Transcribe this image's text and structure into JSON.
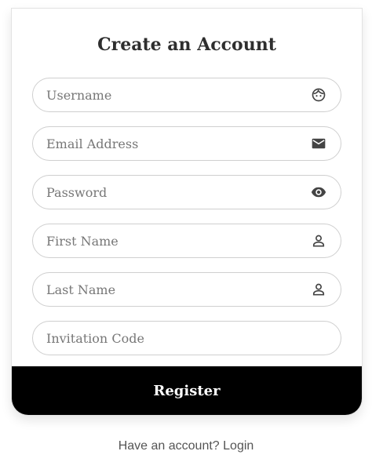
{
  "form": {
    "title": "Create an Account",
    "fields": [
      {
        "placeholder": "Username",
        "value": "",
        "icon": "face-icon"
      },
      {
        "placeholder": "Email Address",
        "value": "",
        "icon": "email-icon"
      },
      {
        "placeholder": "Password",
        "value": "",
        "icon": "eye-icon"
      },
      {
        "placeholder": "First Name",
        "value": "",
        "icon": "person-icon"
      },
      {
        "placeholder": "Last Name",
        "value": "",
        "icon": "person-icon"
      },
      {
        "placeholder": "Invitation Code",
        "value": "",
        "icon": ""
      }
    ],
    "register_label": "Register"
  },
  "footer": {
    "prompt": "Have an account?",
    "login_link": "Login"
  },
  "colors": {
    "button_bg": "#000000",
    "button_text": "#ffffff",
    "border": "#cfcfcf",
    "placeholder": "#777777",
    "icon": "#444444"
  }
}
